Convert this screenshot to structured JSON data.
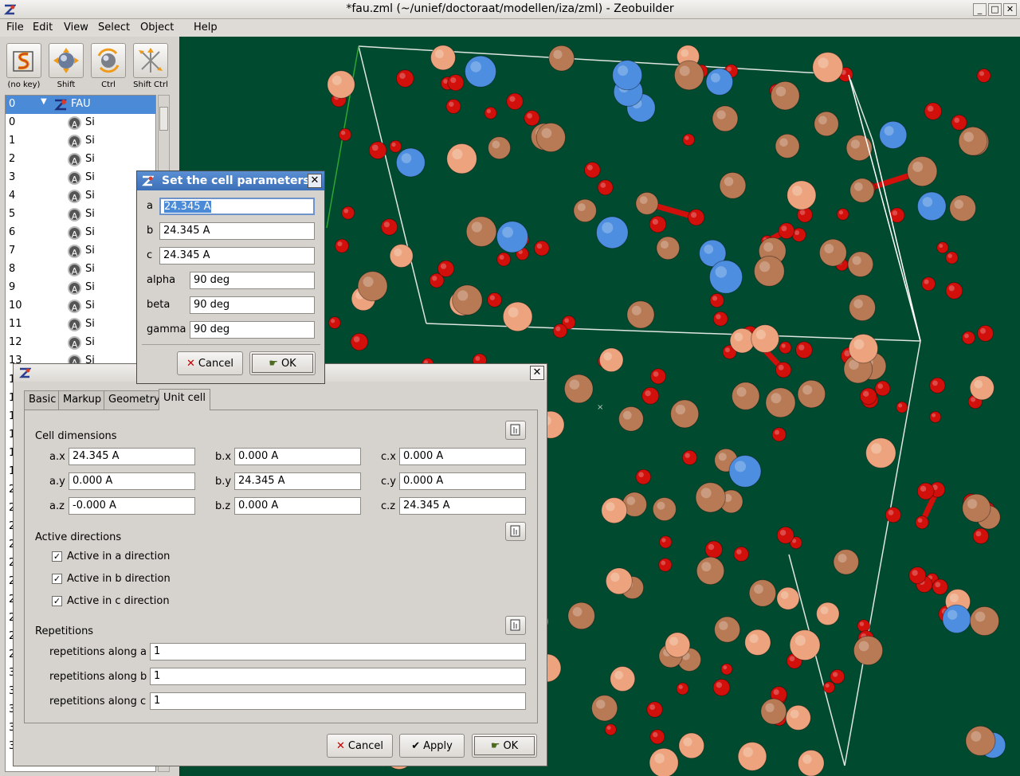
{
  "window": {
    "title": "*fau.zml (~/unief/doctoraat/modellen/iza/zml) - Zeobuilder",
    "controls": [
      "_",
      "□",
      "✕"
    ]
  },
  "menu": [
    "File",
    "Edit",
    "View",
    "Select",
    "Object",
    "Help"
  ],
  "toolbar": [
    {
      "label": "(no key)",
      "icon": "selection-mode-icon"
    },
    {
      "label": "Shift",
      "icon": "rotate-object-icon"
    },
    {
      "label": "Ctrl",
      "icon": "rotate-view-icon"
    },
    {
      "label": "Shift Ctrl",
      "icon": "translate-icon"
    }
  ],
  "tree": {
    "root": {
      "index": "0",
      "label": "FAU"
    },
    "rows": [
      {
        "index": "0",
        "label": "Si"
      },
      {
        "index": "1",
        "label": "Si"
      },
      {
        "index": "2",
        "label": "Si"
      },
      {
        "index": "3",
        "label": "Si"
      },
      {
        "index": "4",
        "label": "Si"
      },
      {
        "index": "5",
        "label": "Si"
      },
      {
        "index": "6",
        "label": "Si"
      },
      {
        "index": "7",
        "label": "Si"
      },
      {
        "index": "8",
        "label": "Si"
      },
      {
        "index": "9",
        "label": "Si"
      },
      {
        "index": "10",
        "label": "Si"
      },
      {
        "index": "11",
        "label": "Si"
      },
      {
        "index": "12",
        "label": "Si"
      },
      {
        "index": "13",
        "label": "Si"
      }
    ],
    "hidden_rows": [
      "1",
      "1",
      "1",
      "1",
      "1",
      "1",
      "2",
      "2",
      "2",
      "2",
      "2",
      "2",
      "2",
      "2",
      "2",
      "2",
      "3",
      "3",
      "3",
      "3",
      "3"
    ]
  },
  "cell_dialog": {
    "title": "Set the cell parameters",
    "fields": [
      {
        "label": "a",
        "value": "24.345 A"
      },
      {
        "label": "b",
        "value": "24.345 A"
      },
      {
        "label": "c",
        "value": "24.345 A"
      },
      {
        "label": "alpha",
        "value": "90 deg"
      },
      {
        "label": "beta",
        "value": "90 deg"
      },
      {
        "label": "gamma",
        "value": "90 deg"
      }
    ],
    "cancel": "Cancel",
    "ok": "OK"
  },
  "props_dialog": {
    "tabs": [
      "Basic",
      "Markup",
      "Geometry",
      "Unit cell"
    ],
    "active_tab": "Unit cell",
    "cell_dimensions": {
      "heading": "Cell dimensions",
      "cells": [
        {
          "label": "a.x",
          "value": "24.345 A"
        },
        {
          "label": "b.x",
          "value": "0.000 A"
        },
        {
          "label": "c.x",
          "value": "0.000 A"
        },
        {
          "label": "a.y",
          "value": "0.000 A"
        },
        {
          "label": "b.y",
          "value": "24.345 A"
        },
        {
          "label": "c.y",
          "value": "0.000 A"
        },
        {
          "label": "a.z",
          "value": "-0.000 A"
        },
        {
          "label": "b.z",
          "value": "0.000 A"
        },
        {
          "label": "c.z",
          "value": "24.345 A"
        }
      ]
    },
    "active_directions": {
      "heading": "Active directions",
      "items": [
        {
          "label": "Active in a direction",
          "checked": true
        },
        {
          "label": "Active in b direction",
          "checked": true
        },
        {
          "label": "Active in c direction",
          "checked": true
        }
      ]
    },
    "repetitions": {
      "heading": "Repetitions",
      "items": [
        {
          "label": "repetitions along a",
          "value": "1"
        },
        {
          "label": "repetitions along b",
          "value": "1"
        },
        {
          "label": "repetitions along c",
          "value": "1"
        }
      ]
    },
    "buttons": {
      "cancel": "Cancel",
      "apply": "Apply",
      "ok": "OK"
    }
  },
  "colors": {
    "viewport_bg": "#004b30",
    "oxygen": "#d10f0b",
    "silicon_brown": "#b87a55",
    "silicon_peach": "#eda47e",
    "aluminium_blue": "#4d8ee0",
    "selection": "#4a8ad6"
  }
}
